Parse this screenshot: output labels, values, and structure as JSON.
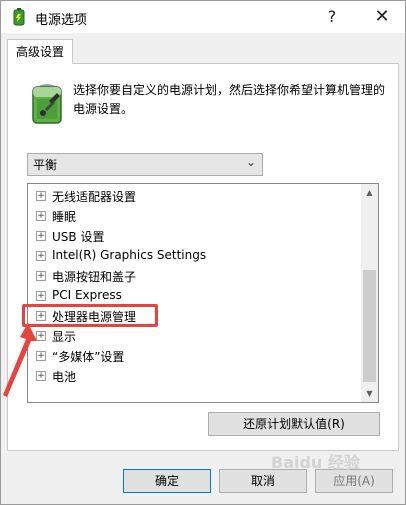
{
  "window": {
    "title": "电源选项",
    "help_label": "?",
    "close_label": "✕"
  },
  "tab": {
    "label": "高级设置"
  },
  "description": "选择你要自定义的电源计划，然后选择你希望计算机管理的电源设置。",
  "plan_select": {
    "value": "平衡"
  },
  "tree_items": [
    {
      "label": "无线适配器设置"
    },
    {
      "label": "睡眠"
    },
    {
      "label": "USB 设置"
    },
    {
      "label": "Intel(R) Graphics Settings"
    },
    {
      "label": "电源按钮和盖子"
    },
    {
      "label": "PCI Express"
    },
    {
      "label": "处理器电源管理"
    },
    {
      "label": "显示"
    },
    {
      "label": "“多媒体”设置"
    },
    {
      "label": "电池"
    }
  ],
  "tree_expander_glyph": "+",
  "buttons": {
    "restore": "还原计划默认值(R)",
    "ok": "确定",
    "cancel": "取消",
    "apply": "应用(A)"
  },
  "watermark": "Baidu 经验",
  "colors": {
    "highlight": "#e8443f",
    "accent": "#0078d7"
  }
}
